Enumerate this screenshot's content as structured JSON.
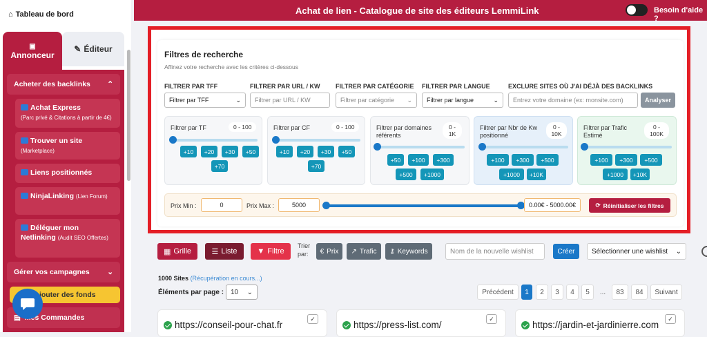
{
  "sidebar": {
    "dashboard": "Tableau de bord",
    "tab_annonceur": "Annonceur",
    "tab_editeur": "Éditeur",
    "section_backlinks": "Acheter des backlinks",
    "items": [
      {
        "label": "Achat Express",
        "sub": "(Parc privé & Citations à partir de 4€)"
      },
      {
        "label": "Trouver un site",
        "sub": "(Marketplace)"
      },
      {
        "label": "Liens positionnés",
        "sub": ""
      },
      {
        "label": "NinjaLinking",
        "sub": "(Lien Forum)"
      },
      {
        "label": "Déléguer mon Netlinking",
        "sub": "(Audit SEO Offertes)"
      }
    ],
    "section_campagnes": "Gérer vos campagnes",
    "add_funds": "Ajouter des fonds",
    "orders": "Mes Commandes"
  },
  "header": {
    "title": "Achat de lien - Catalogue de site des éditeurs LemmiLink",
    "help": "Besoin d'aide ?"
  },
  "filters": {
    "title": "Filtres de recherche",
    "subtitle": "Affinez votre recherche avec les critères ci-dessous",
    "tff_label": "FILTRER PAR TFF",
    "tff_value": "Filtrer par TFF",
    "url_label": "FILTRER PAR URL / KW",
    "url_placeholder": "Filtrer par URL / KW",
    "cat_label": "FILTRER PAR CATÉGORIE",
    "cat_value": "Filtrer par catégorie",
    "lang_label": "FILTRER PAR LANGUE",
    "lang_value": "Filtrer par langue",
    "exclude_label": "EXCLURE SITES OÙ J'AI DÉJÀ DES BACKLINKS",
    "exclude_placeholder": "Entrez votre domaine (ex: monsite.com)",
    "analyse": "Analyser",
    "cards": [
      {
        "title": "Filtrer par TF",
        "range": "0 - 100",
        "chips": [
          "+10",
          "+20",
          "+30",
          "+50",
          "+70"
        ]
      },
      {
        "title": "Filtrer par CF",
        "range": "0 - 100",
        "chips": [
          "+10",
          "+20",
          "+30",
          "+50",
          "+70"
        ]
      },
      {
        "title": "Filtrer par domaines référents",
        "range": "0 - 1K",
        "chips": [
          "+50",
          "+100",
          "+300",
          "+500",
          "+1000"
        ]
      },
      {
        "title": "Filtrer par Nbr de Kw positionné",
        "range": "0 - 10K",
        "chips": [
          "+100",
          "+300",
          "+500",
          "+1000",
          "+10K"
        ]
      },
      {
        "title": "Filtrer par Trafic Estimé",
        "range": "0 - 100K",
        "chips": [
          "+100",
          "+300",
          "+500",
          "+1000",
          "+10K"
        ]
      }
    ],
    "card_colors": [
      "#f6f7f9",
      "#f6f7f9",
      "#f6f7f9",
      "#e6f0fa",
      "#e9f7ee"
    ],
    "price_min_label": "Prix Min :",
    "price_min": "0",
    "price_max_label": "Prix Max :",
    "price_max": "5000",
    "price_range": "0.00€ - 5000.00€",
    "reset": "Réinitialiser les filtres"
  },
  "toolbar": {
    "grid": "Grille",
    "list": "Liste",
    "filter": "Filtre",
    "sort_label": "Trier par:",
    "sort_price": "Prix",
    "sort_traffic": "Trafic",
    "sort_keywords": "Keywords",
    "wishlist_placeholder": "Nom de la nouvelle wishlist",
    "create": "Créer",
    "wishlist_select": "Sélectionner une wishlist"
  },
  "results": {
    "count": "1000 Sites",
    "loading": "(Récupération en cours...)",
    "per_page_label": "Éléments par page :",
    "per_page": "10",
    "pagination": [
      "Précédent",
      "1",
      "2",
      "3",
      "4",
      "5",
      "...",
      "83",
      "84",
      "Suivant"
    ],
    "sites": [
      "https://conseil-pour-chat.fr",
      "https://press-list.com/",
      "https://jardin-et-jardinierre.com"
    ]
  }
}
